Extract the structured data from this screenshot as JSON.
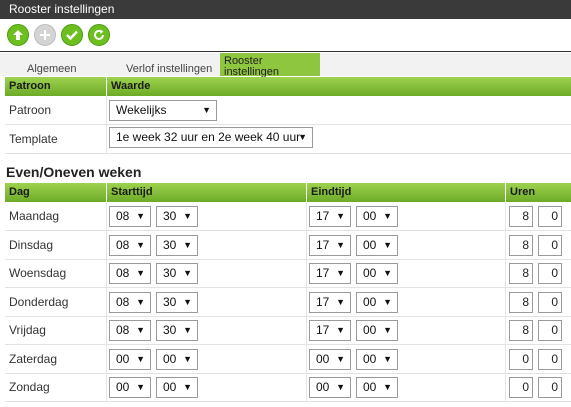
{
  "window": {
    "title": "Rooster instellingen"
  },
  "toolbar": {
    "buttons": [
      {
        "name": "upload-button",
        "icon": "arrow-up-icon",
        "enabled": true
      },
      {
        "name": "add-button",
        "icon": "plus-icon",
        "enabled": false
      },
      {
        "name": "confirm-button",
        "icon": "check-icon",
        "enabled": true
      },
      {
        "name": "refresh-button",
        "icon": "refresh-icon",
        "enabled": true
      }
    ]
  },
  "tabs": [
    {
      "label": "Algemeen",
      "active": false
    },
    {
      "label": "Verlof instellingen",
      "active": false
    },
    {
      "label": "Rooster instellingen",
      "active": true
    }
  ],
  "settings": {
    "headers": {
      "col1": "Patroon",
      "col2": "Waarde"
    },
    "rows": [
      {
        "label": "Patroon",
        "value": "Wekelijks"
      },
      {
        "label": "Template",
        "value": "1e week 32 uur en 2e week 40 uur"
      }
    ]
  },
  "schedule": {
    "section_title": "Even/Oneven weken",
    "headers": {
      "day": "Dag",
      "start": "Starttijd",
      "end": "Eindtijd",
      "hours": "Uren"
    },
    "rows": [
      {
        "day": "Maandag",
        "start_h": "08",
        "start_m": "30",
        "end_h": "17",
        "end_m": "00",
        "hours": "8",
        "minutes": "0"
      },
      {
        "day": "Dinsdag",
        "start_h": "08",
        "start_m": "30",
        "end_h": "17",
        "end_m": "00",
        "hours": "8",
        "minutes": "0"
      },
      {
        "day": "Woensdag",
        "start_h": "08",
        "start_m": "30",
        "end_h": "17",
        "end_m": "00",
        "hours": "8",
        "minutes": "0"
      },
      {
        "day": "Donderdag",
        "start_h": "08",
        "start_m": "30",
        "end_h": "17",
        "end_m": "00",
        "hours": "8",
        "minutes": "0"
      },
      {
        "day": "Vrijdag",
        "start_h": "08",
        "start_m": "30",
        "end_h": "17",
        "end_m": "00",
        "hours": "8",
        "minutes": "0"
      },
      {
        "day": "Zaterdag",
        "start_h": "00",
        "start_m": "00",
        "end_h": "00",
        "end_m": "00",
        "hours": "0",
        "minutes": "0"
      },
      {
        "day": "Zondag",
        "start_h": "00",
        "start_m": "00",
        "end_h": "00",
        "end_m": "00",
        "hours": "0",
        "minutes": "0"
      }
    ]
  },
  "colors": {
    "accent_green": "#8ec63f",
    "titlebar": "#3a3a3a"
  }
}
